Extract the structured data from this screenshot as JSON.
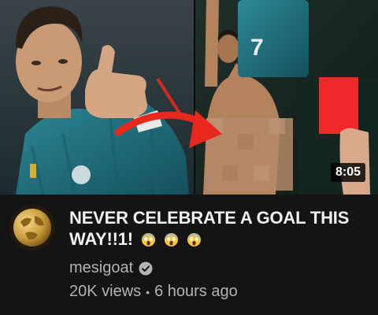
{
  "video": {
    "duration": "8:05",
    "title": "NEVER CELEBRATE A GOAL THIS WAY!!1!",
    "title_emojis": [
      "screaming-face-emoji",
      "screaming-face-emoji",
      "screaming-face-emoji"
    ]
  },
  "channel": {
    "name": "mesigoat",
    "verified_icon": "check-circle-icon"
  },
  "stats": {
    "views": "20K views",
    "separator": "•",
    "age": "6 hours ago"
  },
  "thumbnail": {
    "jersey_number": "7",
    "colors": {
      "arrow": "#e8271d",
      "red_card": "#f0282a",
      "jersey": "#2f7d8a"
    }
  }
}
